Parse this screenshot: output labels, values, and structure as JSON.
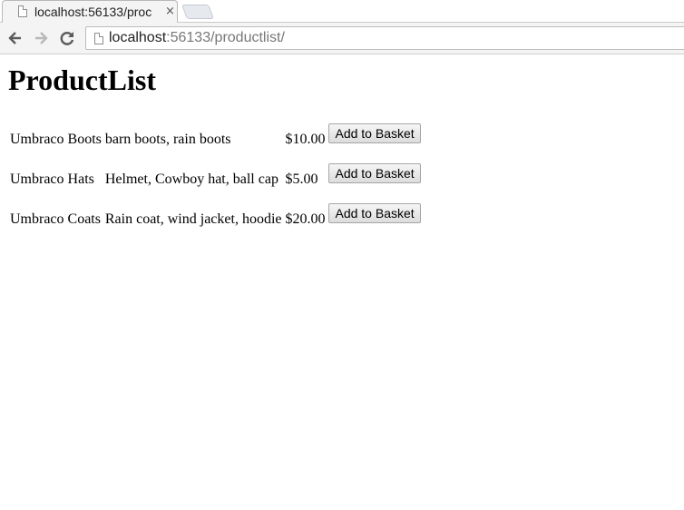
{
  "browser": {
    "tab_title": "localhost:56133/proc",
    "close_glyph": "×",
    "url_host": "localhost",
    "url_rest": ":56133/productlist/",
    "nav": {
      "back": "🡐",
      "forward": "🡒",
      "reload": "↻"
    }
  },
  "page": {
    "title": "ProductList",
    "products": [
      {
        "name": "Umbraco Boots",
        "description": "barn boots, rain boots",
        "price": "$10.00",
        "button": "Add to Basket"
      },
      {
        "name": "Umbraco Hats",
        "description": "Helmet, Cowboy hat, ball cap",
        "price": "$5.00",
        "button": "Add to Basket"
      },
      {
        "name": "Umbraco Coats",
        "description": "Rain coat, wind jacket, hoodie",
        "price": "$20.00",
        "button": "Add to Basket"
      }
    ]
  }
}
